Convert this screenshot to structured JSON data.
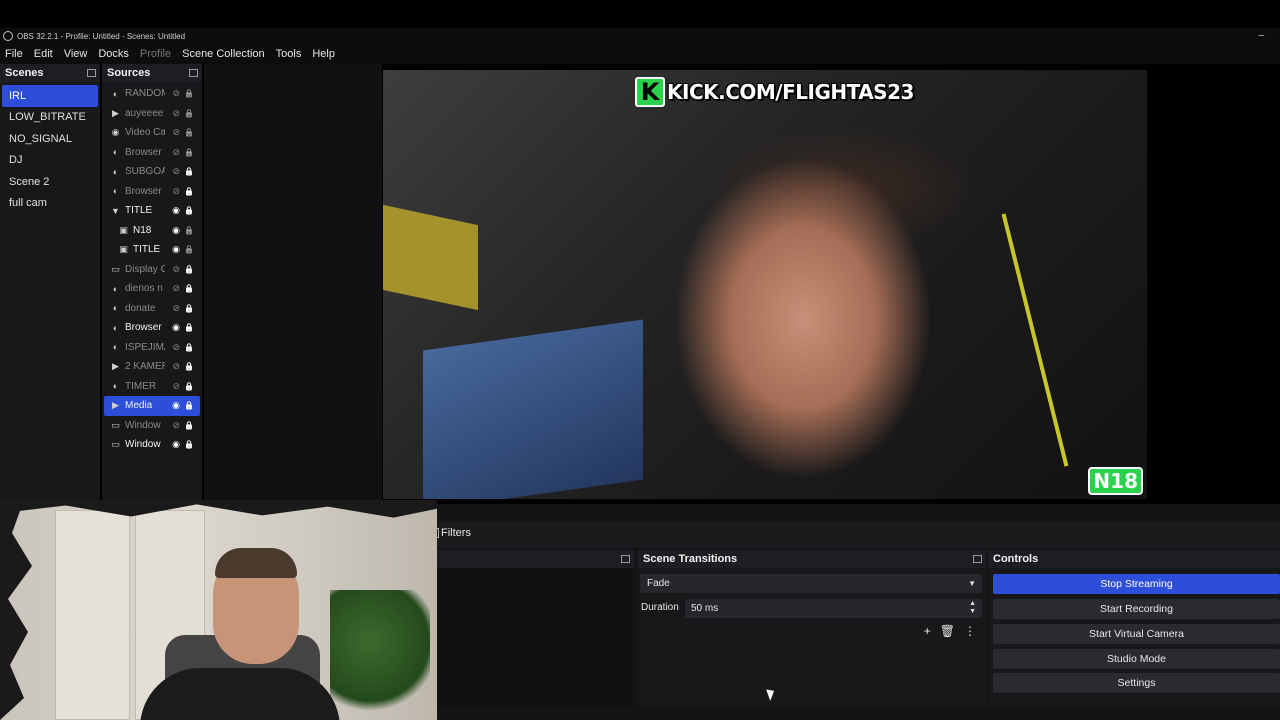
{
  "window": {
    "title": "OBS 32.2.1 - Profile: Untitled - Scenes: Untitled",
    "minimize": "–"
  },
  "menu": [
    "File",
    "Edit",
    "View",
    "Docks",
    "Profile",
    "Scene Collection",
    "Tools",
    "Help"
  ],
  "scenes": {
    "title": "Scenes",
    "items": [
      "IRL",
      "LOW_BITRATE",
      "NO_SIGNAL",
      "DJ",
      "Scene 2",
      "full cam"
    ],
    "selected": "IRL"
  },
  "sources": {
    "title": "Sources",
    "items": [
      {
        "name": "RANDOM",
        "icon": "browser-icon",
        "visible": false,
        "locked": false
      },
      {
        "name": "auyeeee",
        "icon": "media-icon",
        "visible": false,
        "locked": false
      },
      {
        "name": "Video Ca",
        "icon": "camera-icon",
        "visible": false,
        "locked": false
      },
      {
        "name": "Browser",
        "icon": "browser-icon",
        "visible": false,
        "locked": false
      },
      {
        "name": "SUBGOA",
        "icon": "browser-icon",
        "visible": false,
        "locked": true
      },
      {
        "name": "Browser",
        "icon": "browser-icon",
        "visible": false,
        "locked": true
      },
      {
        "name": "TITLE",
        "icon": "group-icon",
        "visible": true,
        "locked": true
      },
      {
        "name": "N18",
        "icon": "image-icon",
        "visible": true,
        "locked": false,
        "child": true
      },
      {
        "name": "TITLE",
        "icon": "image-icon",
        "visible": true,
        "locked": false,
        "child": true
      },
      {
        "name": "Display C",
        "icon": "display-icon",
        "visible": false,
        "locked": true
      },
      {
        "name": "dienos n",
        "icon": "browser-icon",
        "visible": false,
        "locked": true
      },
      {
        "name": "donate",
        "icon": "browser-icon",
        "visible": false,
        "locked": true
      },
      {
        "name": "Browser",
        "icon": "browser-icon",
        "visible": true,
        "locked": true
      },
      {
        "name": "ISPEJIMA",
        "icon": "browser-icon",
        "visible": false,
        "locked": true
      },
      {
        "name": "2 KAMER",
        "icon": "media-icon",
        "visible": false,
        "locked": true
      },
      {
        "name": "TIMER",
        "icon": "browser-icon",
        "visible": false,
        "locked": true
      },
      {
        "name": "Media",
        "icon": "media-icon",
        "visible": true,
        "locked": true,
        "selected": true
      },
      {
        "name": "Window",
        "icon": "window-icon",
        "visible": false,
        "locked": true
      },
      {
        "name": "Window",
        "icon": "window-icon",
        "visible": true,
        "locked": true
      }
    ]
  },
  "preview": {
    "overlay_text": "KICK.COM/FLIGHTAS23",
    "overlay_logo": "K",
    "badge": "N18",
    "colors": {
      "kick_green": "#2bd24b"
    }
  },
  "filters": {
    "label": "Filters"
  },
  "transitions": {
    "title": "Scene Transitions",
    "selected": "Fade",
    "duration_label": "Duration",
    "duration_value": "50 ms",
    "tools": [
      "+",
      "🗑",
      "⋮"
    ]
  },
  "controls": {
    "title": "Controls",
    "buttons": [
      "Stop Streaming",
      "Start Recording",
      "Start Virtual Camera",
      "Studio Mode",
      "Settings"
    ],
    "accent": "#2d4ed8"
  }
}
